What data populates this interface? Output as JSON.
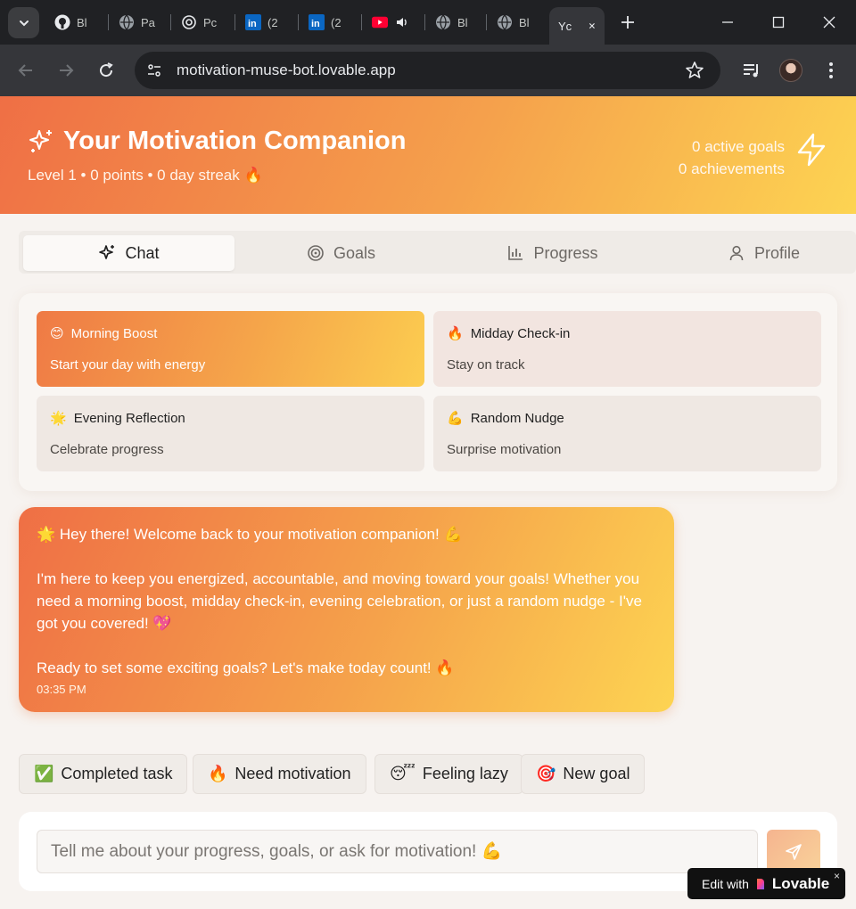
{
  "browser": {
    "tabs": [
      {
        "title": "Bl",
        "icon": "github-icon"
      },
      {
        "title": "Pa",
        "icon": "globe-icon"
      },
      {
        "title": "Pc",
        "icon": "openai-icon"
      },
      {
        "title": "(2",
        "icon": "linkedin-icon"
      },
      {
        "title": "(2",
        "icon": "linkedin-icon"
      },
      {
        "title": "",
        "icon": "youtube-icon"
      },
      {
        "title": "Bl",
        "icon": "globe-icon"
      },
      {
        "title": "Bl",
        "icon": "globe-icon"
      },
      {
        "title": "Yc",
        "icon": "none",
        "active": true
      }
    ],
    "url": "motivation-muse-bot.lovable.app"
  },
  "header": {
    "title": "Your Motivation Companion",
    "subtitle": "Level 1 • 0 points • 0 day streak 🔥",
    "active_goals": "0 active goals",
    "achievements": "0 achievements"
  },
  "tabs": [
    {
      "label": "Chat",
      "icon": "sparkles-icon",
      "selected": true
    },
    {
      "label": "Goals",
      "icon": "target-icon"
    },
    {
      "label": "Progress",
      "icon": "bar-chart-icon"
    },
    {
      "label": "Profile",
      "icon": "user-icon"
    }
  ],
  "modes": [
    {
      "emoji": "😊",
      "title": "Morning Boost",
      "subtitle": "Start your day with energy"
    },
    {
      "emoji": "🔥",
      "title": "Midday Check-in",
      "subtitle": "Stay on track"
    },
    {
      "emoji": "🌟",
      "title": "Evening Reflection",
      "subtitle": "Celebrate progress"
    },
    {
      "emoji": "💪",
      "title": "Random Nudge",
      "subtitle": "Surprise motivation"
    }
  ],
  "message": {
    "line1": "🌟 Hey there! Welcome back to your motivation companion! 💪",
    "line2": "I'm here to keep you energized, accountable, and moving toward your goals! Whether you need a morning boost, midday check-in, evening celebration, or just a random nudge - I've got you covered! 💖",
    "line3": "Ready to set some exciting goals? Let's make today count! 🔥",
    "time": "03:35 PM"
  },
  "quick_replies": [
    {
      "emoji": "✅",
      "label": "Completed task"
    },
    {
      "emoji": "🔥",
      "label": "Need motivation"
    },
    {
      "emoji": "😴",
      "label": "Feeling lazy"
    },
    {
      "emoji": "🎯",
      "label": "New goal"
    }
  ],
  "composer": {
    "placeholder": "Tell me about your progress, goals, or ask for motivation! 💪"
  },
  "badge": {
    "prefix": "Edit with",
    "brand": "Lovable",
    "close": "×"
  },
  "colors": {
    "accent_start": "#ef6f45",
    "accent_end": "#fdd452",
    "page_bg": "#f7f3f0"
  }
}
